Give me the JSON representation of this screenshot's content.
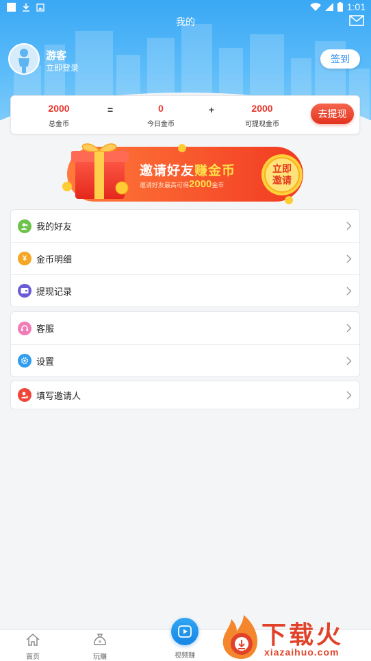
{
  "status_bar": {
    "time": "1:01"
  },
  "header": {
    "title": "我的"
  },
  "user": {
    "name": "游客",
    "login_link": "立即登录",
    "signin_label": "签到"
  },
  "coins": {
    "total": {
      "value": "2000",
      "label": "总金币"
    },
    "op1": "=",
    "today": {
      "value": "0",
      "label": "今日金币"
    },
    "op2": "+",
    "withdrawable": {
      "value": "2000",
      "label": "可提现金币"
    },
    "withdraw_label": "去提现"
  },
  "banner": {
    "title_part1": "邀请好友",
    "title_part2": "赚金币",
    "subtitle_prefix": "邀请好友最高可得",
    "subtitle_amount": "2000",
    "subtitle_suffix": "金币",
    "cta_line1": "立即",
    "cta_line2": "邀请"
  },
  "menu_groups": [
    [
      {
        "label": "我的好友",
        "icon": "friends-icon",
        "color": "#6cc24a"
      },
      {
        "label": "金币明细",
        "icon": "yuan-coin-icon",
        "color": "#f5a623"
      },
      {
        "label": "提现记录",
        "icon": "wallet-icon",
        "color": "#6b5bd6"
      }
    ],
    [
      {
        "label": "客服",
        "icon": "headset-icon",
        "color": "#f07cb8"
      },
      {
        "label": "设置",
        "icon": "gear-icon",
        "color": "#2f9df0"
      }
    ],
    [
      {
        "label": "填写邀请人",
        "icon": "invite-person-icon",
        "color": "#f0463a"
      }
    ]
  ],
  "bottom_nav": {
    "home": "首页",
    "play_earn": "玩赚",
    "video_earn": "视频赚"
  },
  "watermark": {
    "brand": "下载火",
    "domain": "xiazaihuo.com"
  }
}
